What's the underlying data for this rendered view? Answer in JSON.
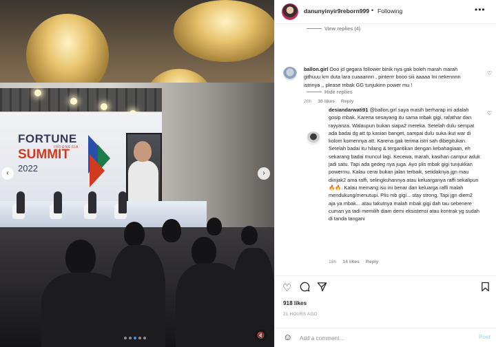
{
  "post": {
    "username": "danunyinyir9reborn999",
    "separator": "•",
    "follow_status": "Following",
    "more_icon": "more-horizontal-icon"
  },
  "media": {
    "event_brand_line1": "FORTUNE",
    "event_brand_line2": "INDONESIA",
    "event_brand_line3": "SUMMIT",
    "event_brand_year": "2022",
    "slide_count": 5,
    "active_slide": 2,
    "prev_icon": "‹",
    "next_icon": "›",
    "sound_icon": "🔇"
  },
  "thread": {
    "view_replies_label": "View replies (4)",
    "hide_replies_label": "Hide replies"
  },
  "comments": [
    {
      "username": "ballon.girl",
      "text": "Ooo jd gegara follower binik nya gak boleh marah marah githuuu krn duta lara cuaaannn , pinterrr booo siii aaaaa Ini nekennnn istrinya ,, please mbak GG tunjukinn power mu !",
      "time": "20h",
      "likes": "30 likes",
      "reply_label": "Reply"
    },
    {
      "username": "desiandarwati91",
      "text": "@ballon.girl saya masih berharap ini adalah gosip mbak. Karena sesayang itu sama mbak gigi, rafathar dan rayyanza. Walaupun bukan siapa2 mereka. Setelah dulu sempat ada badai dg att tp kasian banget, sampai dulu suka ikut war di kolom komennya att. Karena gak terima istri sah dibegitukan. Setelah badai itu hilang & tergantikan dengan kebahagiaan, eh sekarang badai muncul lagi. Kecewa, marah, kasihan campur aduk jadi satu. Tapi ada gedeg nya juga. Ayo plis mbak gigi tunjukkan powermu. Kalau cerai bukan jalan terbaik, setidaknya jgn mau diinjak2 ama raffi, selingkuhannya atau keluarganya raffi sekalipun 🔥🔥. Kalau memang isu ini benar dan keluarga raffi malah mendukung/menutupi. Plis mb gigi... stay strong. Tapi jgn diem2 aja ya mbak... atau takutnya malah mbak gigi dah tau sebenere cuman ya tadi memilih diam demi eksistensi atau kontrak yg sudah di tanda tangani",
      "time": "18h",
      "likes": "14 likes",
      "reply_label": "Reply"
    }
  ],
  "actions": {
    "like_icon": "heart-icon",
    "comment_icon": "comment-icon",
    "share_icon": "share-icon",
    "save_icon": "bookmark-icon",
    "likes_count": "918 likes",
    "timestamp": "21 HOURS AGO"
  },
  "add_comment": {
    "emoji_icon": "emoji-icon",
    "placeholder": "Add a comment…",
    "post_label": "Post",
    "post_color": "#b2dffc"
  },
  "colors": {
    "text": "#262626",
    "muted": "#8e8e8e",
    "accent": "#3897f0"
  }
}
